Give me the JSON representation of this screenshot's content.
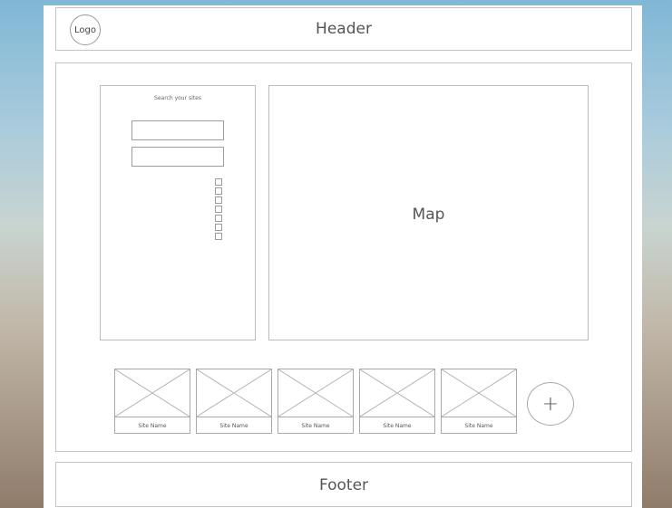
{
  "header": {
    "logo_label": "Logo",
    "title": "Header"
  },
  "search": {
    "title": "Search your sites",
    "fields": [
      "",
      ""
    ],
    "checkbox_count": 7
  },
  "map": {
    "label": "Map"
  },
  "sites": [
    {
      "name": "Site Name"
    },
    {
      "name": "Site Name"
    },
    {
      "name": "Site Name"
    },
    {
      "name": "Site Name"
    },
    {
      "name": "Site Name"
    }
  ],
  "add_button": {
    "icon": "plus-icon",
    "label": "+"
  },
  "footer": {
    "title": "Footer"
  }
}
